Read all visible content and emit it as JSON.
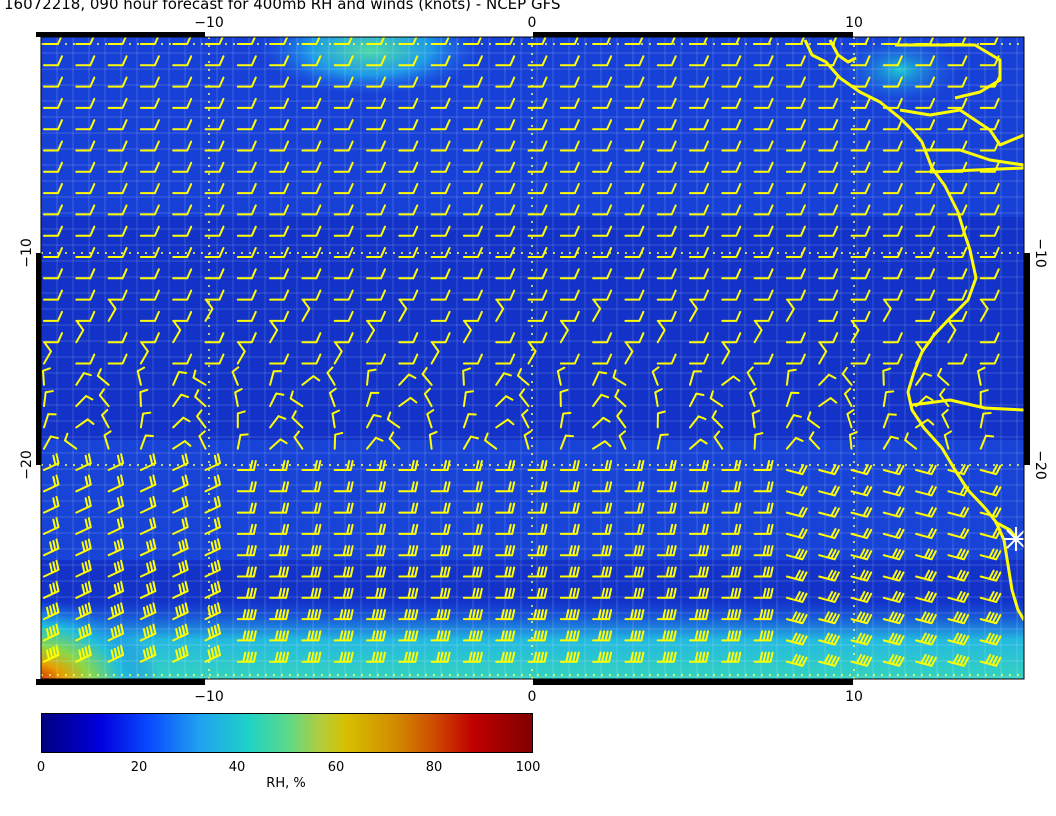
{
  "title": "16072218, 090 hour forecast for 400mb RH and winds (knots) - NCEP GFS",
  "axes": {
    "top_labels": [
      "−10",
      "0",
      "10"
    ],
    "bottom_labels": [
      "−10",
      "0",
      "10"
    ],
    "left_labels": [
      "−10",
      "−20"
    ],
    "right_labels": [
      "−10",
      "−20"
    ]
  },
  "colorbar": {
    "label": "RH, %",
    "ticks": [
      "0",
      "20",
      "40",
      "60",
      "80",
      "100"
    ],
    "range": [
      0,
      100
    ]
  },
  "map": {
    "lon_range": [
      -15.5,
      15.3
    ],
    "lat_range": [
      -29.5,
      -0.3
    ],
    "coastline_color": "#ffff00",
    "barb_color": "#ffff00",
    "gridline_color": "#ffffff",
    "marker": "asterisk"
  }
}
